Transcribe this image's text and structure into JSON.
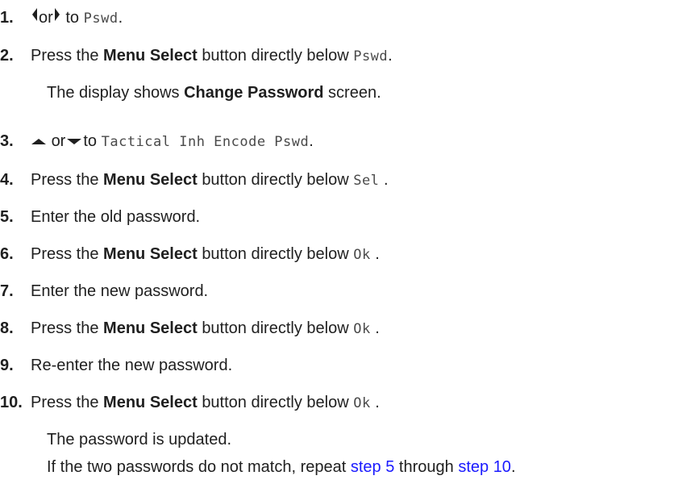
{
  "steps": [
    {
      "num": "1.",
      "or": "or",
      "to": "to",
      "target": "Pswd",
      "end": "."
    },
    {
      "num": "2.",
      "pre": "Press the",
      "bold": "Menu Select",
      "post": "button directly below",
      "target": "Pswd",
      "end": ".",
      "note_pre": "The display shows",
      "note_bold": "Change Password",
      "note_post": "screen."
    },
    {
      "num": "3.",
      "or": "or",
      "to": "to",
      "target": "Tactical Inh Encode Pswd",
      "end": "."
    },
    {
      "num": "4.",
      "pre": "Press the",
      "bold": "Menu Select",
      "post": "button directly below",
      "target": "Sel",
      "end": "."
    },
    {
      "num": "5.",
      "text": "Enter the old password."
    },
    {
      "num": "6.",
      "pre": "Press the",
      "bold": "Menu Select",
      "post": "button directly below",
      "target": "Ok",
      "end": "."
    },
    {
      "num": "7.",
      "text": "Enter the new password."
    },
    {
      "num": "8.",
      "pre": "Press the",
      "bold": "Menu Select",
      "post": "button directly below",
      "target": "Ok",
      "end": "."
    },
    {
      "num": "9.",
      "text": "Re-enter the new password."
    },
    {
      "num": "10.",
      "pre": "Press the",
      "bold": "Menu Select",
      "post": "button directly below",
      "target": "Ok",
      "end": ".",
      "note1": "The password is updated.",
      "note2_pre": "If the two passwords do not match, repeat",
      "link1": "step 5",
      "note2_mid": "through",
      "link2": "step 10",
      "note2_end": "."
    }
  ],
  "icons": [
    "left-arrow-icon",
    "right-arrow-icon",
    "up-arrow-icon",
    "down-arrow-icon"
  ],
  "colors": {
    "link": "#1a1aff",
    "text": "#1f1f1f"
  }
}
